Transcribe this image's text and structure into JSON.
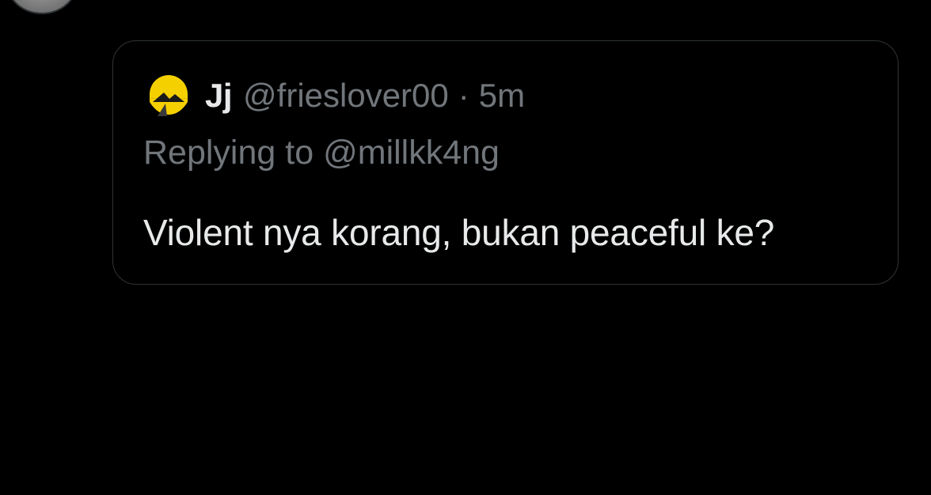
{
  "quote": {
    "display_name": "Jj",
    "handle": "@frieslover00",
    "separator": "·",
    "time": "5m",
    "replying_prefix": "Replying to",
    "replying_handle": "@millkk4ng",
    "text": "Violent nya korang, bukan peaceful ke?",
    "avatar_icon": "yellow-sun-mountain-avatar",
    "avatar_color": "#f5d000"
  },
  "colors": {
    "background": "#000000",
    "primary_text": "#e7e9ea",
    "secondary_text": "#71767b",
    "border": "#2f3336"
  }
}
